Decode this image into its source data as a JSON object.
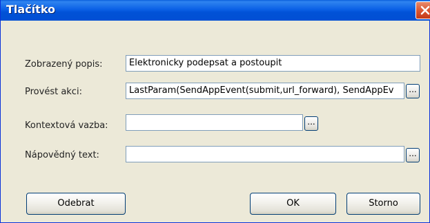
{
  "window": {
    "title": "Tlačítko"
  },
  "fields": [
    {
      "label": "Zobrazený popis:",
      "value": "Elektronicky podepsat a postoupit"
    },
    {
      "label": "Provést akci:",
      "value": "LastParam(SendAppEvent(submit,url_forward), SendAppEv",
      "button_label": "..."
    },
    {
      "label": "Kontextová vazba:",
      "value": "",
      "button_label": "..."
    },
    {
      "label": "Nápovědný text:",
      "value": "",
      "button_label": "..."
    }
  ],
  "buttons": {
    "remove": "Odebrat",
    "ok": "OK",
    "cancel": "Storno"
  },
  "colors": {
    "titlebar": "#0151d6",
    "dialog_bg": "#ece9d8",
    "close_button": "#d8532f"
  },
  "icons": {
    "close": "close-icon"
  }
}
